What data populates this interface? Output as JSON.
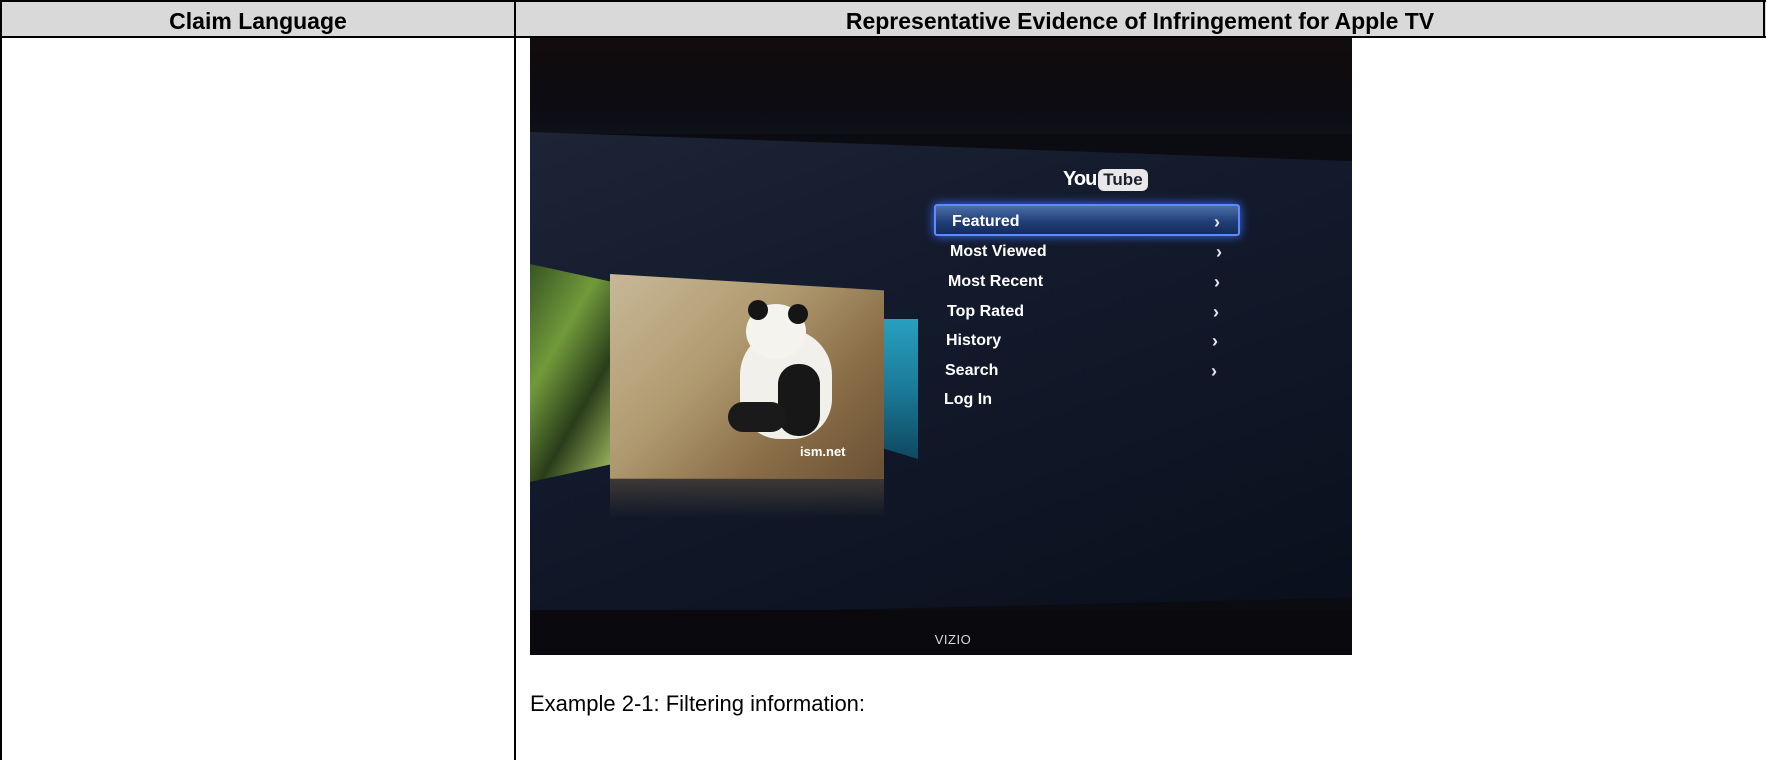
{
  "table": {
    "header_left": "Claim Language",
    "header_right": "Representative Evidence of Infringement for Apple TV"
  },
  "tv_photo": {
    "youtube_logo_you": "You",
    "youtube_logo_tube": "Tube",
    "menu_items": [
      {
        "label": "Featured",
        "chevron": "›",
        "selected": true
      },
      {
        "label": "Most Viewed",
        "chevron": "›"
      },
      {
        "label": "Most Recent",
        "chevron": "›"
      },
      {
        "label": "Top Rated",
        "chevron": "›"
      },
      {
        "label": "History",
        "chevron": "›"
      },
      {
        "label": "Search",
        "chevron": "›"
      },
      {
        "label": "Log In",
        "chevron": ""
      }
    ],
    "thumbnail_watermark": "ism.net",
    "tv_brand": "VIZIO"
  },
  "caption": "Example 2-1: Filtering information:",
  "colors": {
    "header_bg": "#d9d9d9",
    "selection_glow": "#3c6cff",
    "screen_bg": "#141b2d"
  }
}
